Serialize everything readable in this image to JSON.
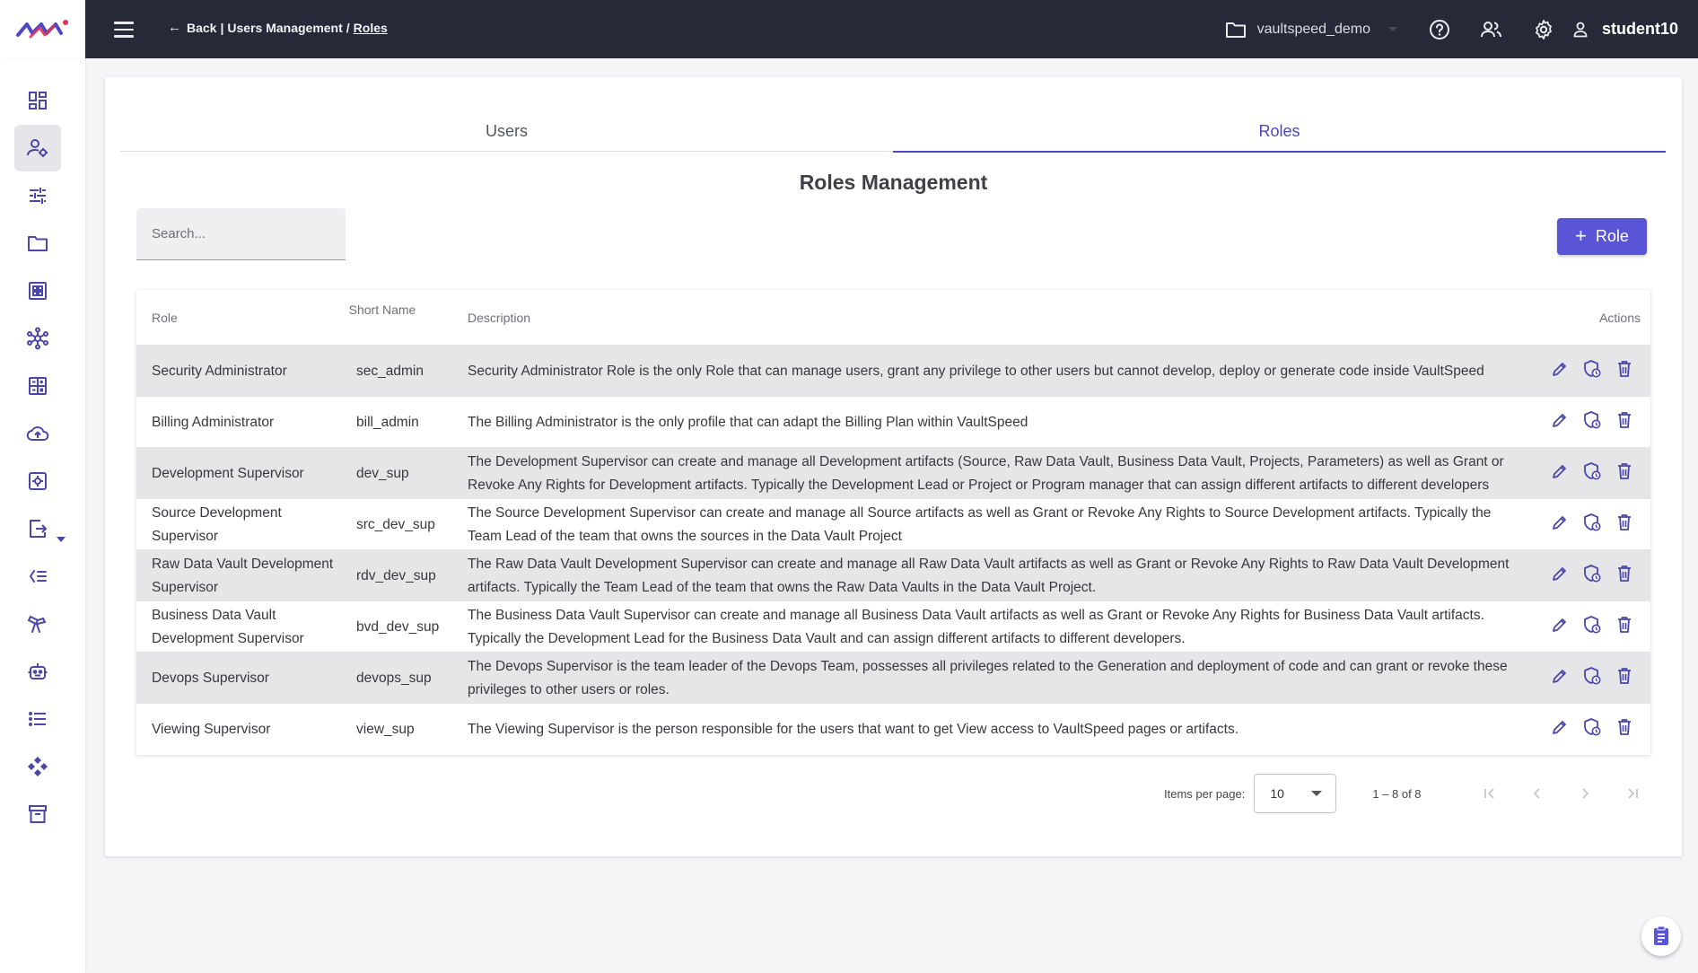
{
  "header": {
    "breadcrumb": {
      "back": "Back",
      "section": "Users Management",
      "current": "Roles"
    },
    "project": "vaultspeed_demo",
    "username": "student10"
  },
  "tabs": [
    {
      "label": "Users",
      "active": false
    },
    {
      "label": "Roles",
      "active": true
    }
  ],
  "page_title": "Roles Management",
  "search": {
    "placeholder": "Search...",
    "value": ""
  },
  "add_button": {
    "label": "Role"
  },
  "table": {
    "columns": {
      "role": "Role",
      "short_name": "Short Name",
      "description": "Description",
      "actions": "Actions"
    },
    "rows": [
      {
        "role": "Security Administrator",
        "short": "sec_admin",
        "description": "Security Administrator Role is the only Role that can manage users, grant any privilege to other users but cannot develop, deploy or generate code inside VaultSpeed"
      },
      {
        "role": "Billing Administrator",
        "short": "bill_admin",
        "description": "The Billing Administrator is the only profile that can adapt the Billing Plan within VaultSpeed"
      },
      {
        "role": "Development Supervisor",
        "short": "dev_sup",
        "description": "The Development Supervisor can create and manage all Development artifacts (Source, Raw Data Vault, Business Data Vault, Projects, Parameters) as well as Grant or Revoke Any Rights for Development artifacts. Typically the Development Lead or Project or Program manager that can assign different artifacts to different developers"
      },
      {
        "role": "Source Development Supervisor",
        "short": "src_dev_sup",
        "description": "The Source Development Supervisor can create and manage all Source artifacts as well as Grant or Revoke Any Rights to Source Development artifacts. Typically the Team Lead of the team that owns the sources in the Data Vault Project"
      },
      {
        "role": "Raw Data Vault Development Supervisor",
        "short": "rdv_dev_sup",
        "description": "The Raw Data Vault Development Supervisor can create and manage all Raw Data Vault artifacts as well as Grant or Revoke Any Rights to Raw Data Vault Development artifacts. Typically the Team Lead of the team that owns the Raw Data Vaults in the Data Vault Project."
      },
      {
        "role": "Business Data Vault Development Supervisor",
        "short": "bvd_dev_sup",
        "description": "The Business Data Vault Supervisor can create and manage all Business Data Vault artifacts as well as Grant or Revoke Any Rights for Business Data Vault artifacts. Typically the Development Lead for the Business Data Vault and can assign different artifacts to different developers."
      },
      {
        "role": "Devops Supervisor",
        "short": "devops_sup",
        "description": "The Devops Supervisor is the team leader of the Devops Team, possesses all privileges related to the Generation and deployment of code and can grant or revoke these privileges to other users or roles."
      },
      {
        "role": "Viewing Supervisor",
        "short": "view_sup",
        "description": "The Viewing Supervisor is the person responsible for the users that want to get View access to VaultSpeed pages or artifacts."
      }
    ]
  },
  "paginator": {
    "label": "Items per page:",
    "page_size": "10",
    "range": "1 – 8 of 8"
  },
  "colors": {
    "accent": "#5a55d6",
    "topbar": "#262a38",
    "icon": "#4b47a8"
  }
}
